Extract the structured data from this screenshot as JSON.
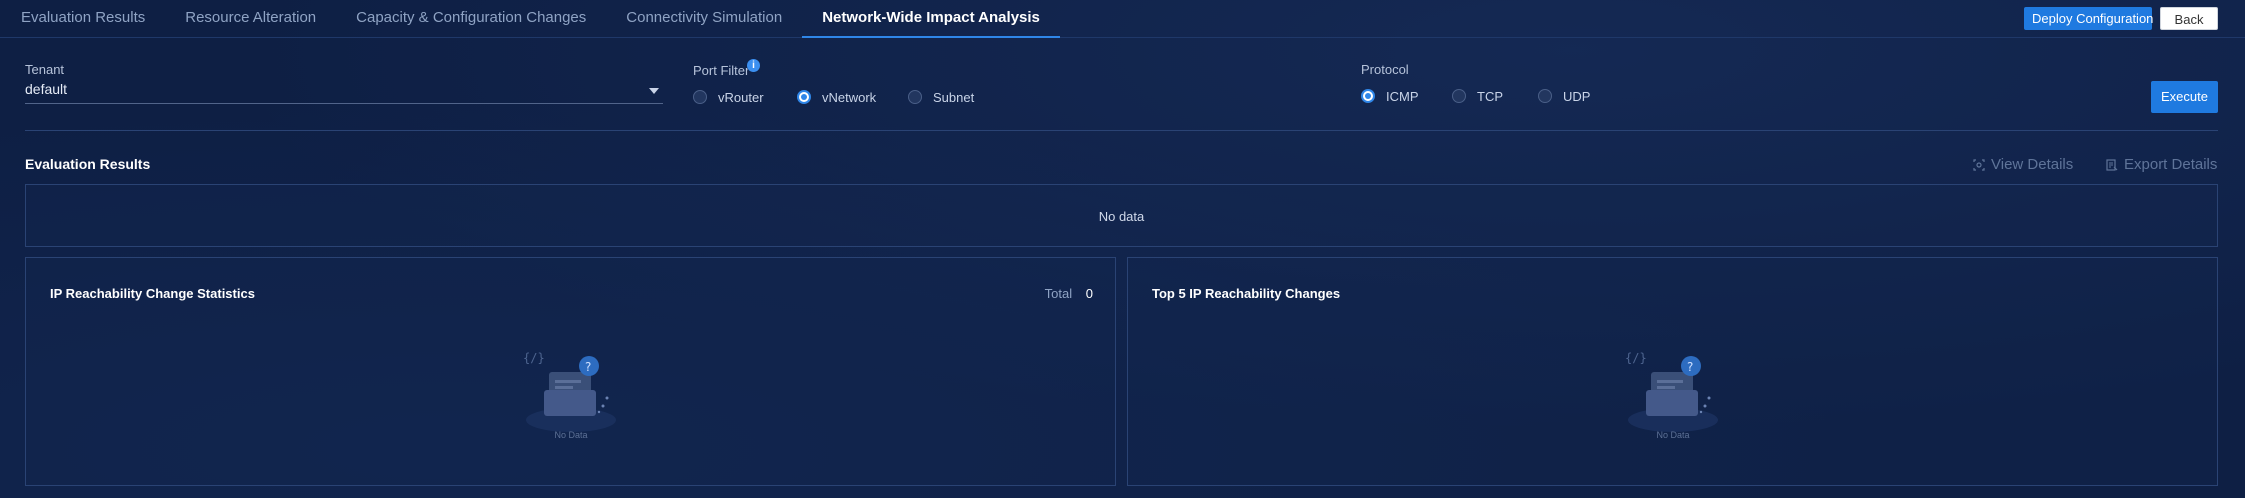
{
  "tabs": [
    {
      "label": "Evaluation Results",
      "active": false
    },
    {
      "label": "Resource Alteration",
      "active": false
    },
    {
      "label": "Capacity & Configuration Changes",
      "active": false
    },
    {
      "label": "Connectivity Simulation",
      "active": false
    },
    {
      "label": "Network-Wide Impact Analysis",
      "active": true
    }
  ],
  "header": {
    "deploy_label": "Deploy Configuration",
    "back_label": "Back"
  },
  "filters": {
    "tenant_label": "Tenant",
    "tenant_value": "default",
    "port_filter_label": "Port Filter",
    "port_options": [
      {
        "label": "vRouter",
        "checked": false
      },
      {
        "label": "vNetwork",
        "checked": true
      },
      {
        "label": "Subnet",
        "checked": false
      }
    ],
    "protocol_label": "Protocol",
    "protocol_options": [
      {
        "label": "ICMP",
        "checked": true
      },
      {
        "label": "TCP",
        "checked": false
      },
      {
        "label": "UDP",
        "checked": false
      }
    ],
    "execute_label": "Execute"
  },
  "results": {
    "title": "Evaluation Results",
    "view_details_label": "View Details",
    "export_details_label": "Export Details",
    "empty_text": "No data"
  },
  "panels": {
    "stats": {
      "title": "IP Reachability Change Statistics",
      "total_label": "Total",
      "total_value": "0",
      "empty_text": "No Data"
    },
    "top5": {
      "title": "Top 5 IP Reachability Changes",
      "empty_text": "No Data"
    }
  },
  "colors": {
    "background": "#0e1f44",
    "accent": "#1f7ae0",
    "active_tab_underline": "#2f86e8"
  }
}
